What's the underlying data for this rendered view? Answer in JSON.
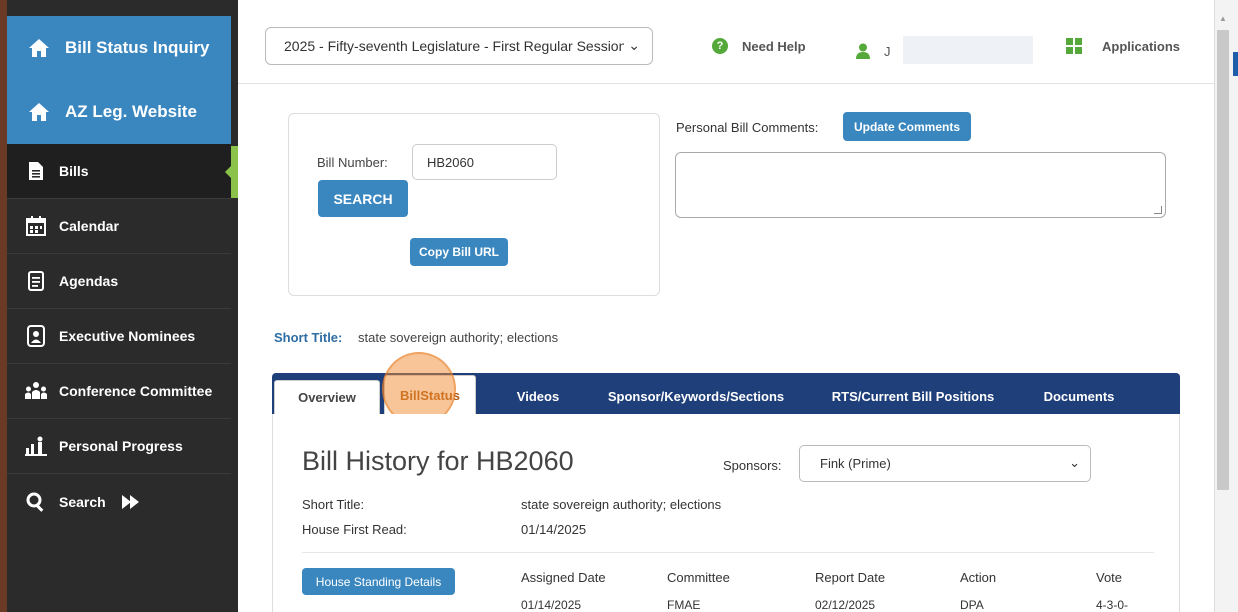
{
  "sidebar": {
    "top_links": [
      {
        "label": "Bill Status Inquiry"
      },
      {
        "label": "AZ Leg. Website"
      }
    ],
    "items": [
      {
        "label": "Bills"
      },
      {
        "label": "Calendar"
      },
      {
        "label": "Agendas"
      },
      {
        "label": "Executive Nominees"
      },
      {
        "label": "Conference Committee"
      },
      {
        "label": "Personal Progress"
      },
      {
        "label": "Search"
      }
    ]
  },
  "topbar": {
    "session": "2025 - Fifty-seventh Legislature - First Regular Session",
    "need_help": "Need Help",
    "user_initial": "J",
    "applications": "Applications"
  },
  "search": {
    "bill_number_label": "Bill Number:",
    "bill_number_value": "HB2060",
    "search_button": "SEARCH",
    "copy_url_button": "Copy Bill URL"
  },
  "comments": {
    "label": "Personal Bill Comments:",
    "update_button": "Update Comments",
    "value": ""
  },
  "short_title": {
    "label": "Short Title:",
    "value": "state sovereign authority; elections"
  },
  "tabs": [
    {
      "label": "Overview"
    },
    {
      "label": "BillStatus"
    },
    {
      "label": "Videos"
    },
    {
      "label": "Sponsor/Keywords/Sections"
    },
    {
      "label": "RTS/Current Bill Positions"
    },
    {
      "label": "Documents"
    }
  ],
  "history": {
    "title": "Bill History for HB2060",
    "sponsors_label": "Sponsors:",
    "sponsors_value": "Fink (Prime)",
    "rows": [
      {
        "label": "Short Title:",
        "value": "state sovereign authority; elections"
      },
      {
        "label": "House First Read:",
        "value": "01/14/2025"
      }
    ],
    "standing_button": "House Standing Details",
    "columns": [
      "Assigned Date",
      "Committee",
      "Report Date",
      "Action",
      "Vote"
    ],
    "values": [
      "01/14/2025",
      "FMAE",
      "02/12/2025",
      "DPA",
      "4-3-0-"
    ]
  }
}
